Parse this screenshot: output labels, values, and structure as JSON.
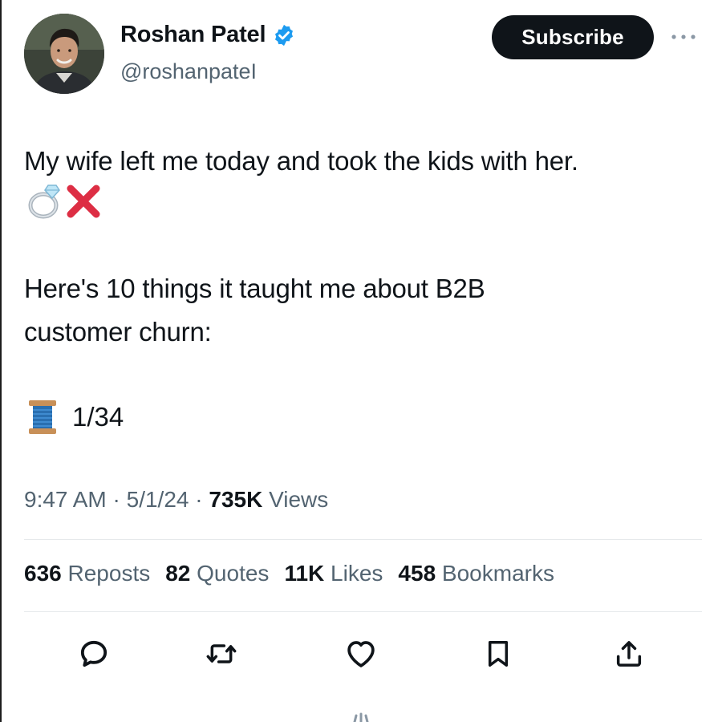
{
  "author": {
    "name": "Roshan Patel",
    "handle": "@roshanpateI",
    "verified": true,
    "verified_color": "#1d9bf0",
    "avatar_icon": "profile-photo"
  },
  "header": {
    "subscribe_label": "Subscribe",
    "more_icon": "ellipsis-icon"
  },
  "tweet": {
    "line1": "My wife left me today and took the kids with her.",
    "line1_emojis": [
      "ring-emoji",
      "cross-mark-emoji"
    ],
    "line2": "Here's 10 things it taught me about B2B",
    "line3": "customer churn:",
    "thread_icon": "thread-spool-emoji",
    "thread_count": "1/34"
  },
  "meta": {
    "time": "9:47 AM",
    "sep1": " · ",
    "date": "5/1/24",
    "sep2": " · ",
    "views_count": "735K",
    "views_label": " Views"
  },
  "stats": {
    "reposts_count": "636",
    "reposts_label": "Reposts",
    "quotes_count": "82",
    "quotes_label": "Quotes",
    "likes_count": "11K",
    "likes_label": "Likes",
    "bookmarks_count": "458",
    "bookmarks_label": "Bookmarks"
  },
  "actions": [
    "reply-icon",
    "repost-icon",
    "like-icon",
    "bookmark-icon",
    "share-icon"
  ],
  "colors": {
    "text": "#0f1419",
    "secondary": "#536471",
    "divider": "#e6e9eb",
    "button_bg": "#0f1419",
    "cross": "#dd2e44"
  }
}
